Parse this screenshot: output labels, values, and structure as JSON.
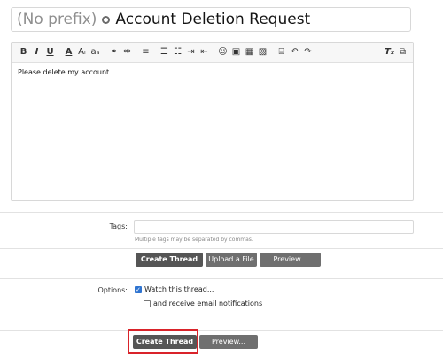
{
  "title": {
    "prefix": "(No prefix)",
    "text": "Account Deletion Request"
  },
  "editor": {
    "body": "Please delete my account.",
    "toolbar_left": [
      "B",
      "I",
      "U",
      "A",
      "Aᵢ",
      "aₐ",
      "⚭",
      "⚮",
      "≡",
      "☰",
      "☷",
      "⇥",
      "⇤",
      "☺",
      "▣",
      "▦",
      "▧",
      "⌸",
      "↶",
      "↷"
    ],
    "toolbar_right": [
      "Tₓ",
      "⧉"
    ]
  },
  "tags": {
    "label": "Tags:",
    "value": "",
    "hint": "Multiple tags may be separated by commas."
  },
  "actions_upper": {
    "create": "Create Thread",
    "upload": "Upload a File",
    "preview": "Preview..."
  },
  "options": {
    "label": "Options:",
    "watch": {
      "label": "Watch this thread...",
      "checked": true
    },
    "email": {
      "label": "and receive email notifications",
      "checked": false
    }
  },
  "actions_lower": {
    "create": "Create Thread",
    "preview": "Preview..."
  },
  "colors": {
    "button": "#555555",
    "highlight": "#d9232a",
    "check": "#2f74d0"
  }
}
